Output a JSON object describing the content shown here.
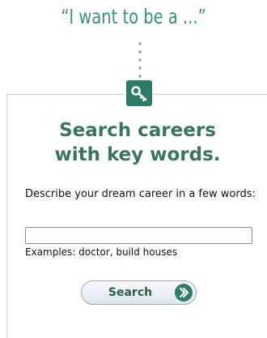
{
  "quote": "“I want to be a ...”",
  "panel": {
    "heading_line1": "Search careers",
    "heading_line2": "with key words.",
    "description": "Describe your dream career in a few words:",
    "input_value": "",
    "examples": "Examples: doctor, build houses",
    "search_label": "Search"
  },
  "icons": {
    "badge": "key-icon",
    "button": "arrow-right-circle-icon"
  },
  "colors": {
    "accent": "#3a7364",
    "badge_bg": "#2f7a68",
    "quote": "#3f8f7d"
  }
}
